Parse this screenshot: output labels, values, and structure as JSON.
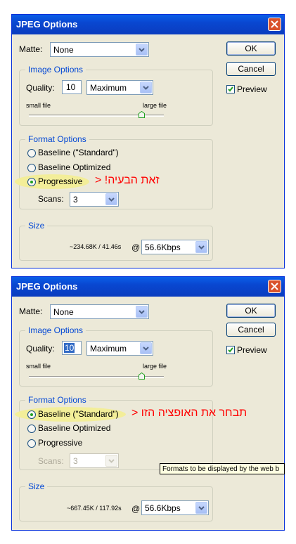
{
  "dialog_top": {
    "title": "JPEG Options",
    "matte_label": "Matte:",
    "matte_value": "None",
    "ok_label": "OK",
    "cancel_label": "Cancel",
    "preview_label": "Preview",
    "preview_checked": true,
    "image_options": {
      "legend": "Image Options",
      "quality_label": "Quality:",
      "quality_value": "10",
      "quality_preset": "Maximum",
      "small_file": "small file",
      "large_file": "large file",
      "slider_level": 0.82
    },
    "format_options": {
      "legend": "Format Options",
      "options": [
        "Baseline (\"Standard\")",
        "Baseline Optimized",
        "Progressive"
      ],
      "selected_index": 2,
      "scans_label": "Scans:",
      "scans_value": "3"
    },
    "size": {
      "legend": "Size",
      "estimate": "~234.68K / 41.46s",
      "at": "@",
      "speed": "56.6Kbps"
    },
    "annotation": "זאת הבעיה! <"
  },
  "dialog_bottom": {
    "title": "JPEG Options",
    "matte_label": "Matte:",
    "matte_value": "None",
    "ok_label": "OK",
    "cancel_label": "Cancel",
    "preview_label": "Preview",
    "preview_checked": true,
    "image_options": {
      "legend": "Image Options",
      "quality_label": "Quality:",
      "quality_value": "10",
      "quality_preset": "Maximum",
      "small_file": "small file",
      "large_file": "large file",
      "slider_level": 0.82
    },
    "format_options": {
      "legend": "Format Options",
      "options": [
        "Baseline (\"Standard\")",
        "Baseline Optimized",
        "Progressive"
      ],
      "selected_index": 0,
      "scans_label": "Scans:",
      "scans_value": "3"
    },
    "size": {
      "legend": "Size",
      "estimate": "~667.45K / 117.92s",
      "at": "@",
      "speed": "56.6Kbps"
    },
    "tooltip": "Formats to be displayed by the web b",
    "annotation": "תבחר את האופציה הזו <"
  },
  "colors": {
    "title_bar": "#0a5ee7",
    "close_button": "#d9522b",
    "annotation": "#ff0000",
    "highlight": "#f3ee99",
    "legend_text": "#0046d5"
  },
  "icons": [
    "close-icon",
    "dropdown-arrow-icon",
    "checkmark-icon",
    "radio-icon",
    "slider-thumb-icon"
  ]
}
